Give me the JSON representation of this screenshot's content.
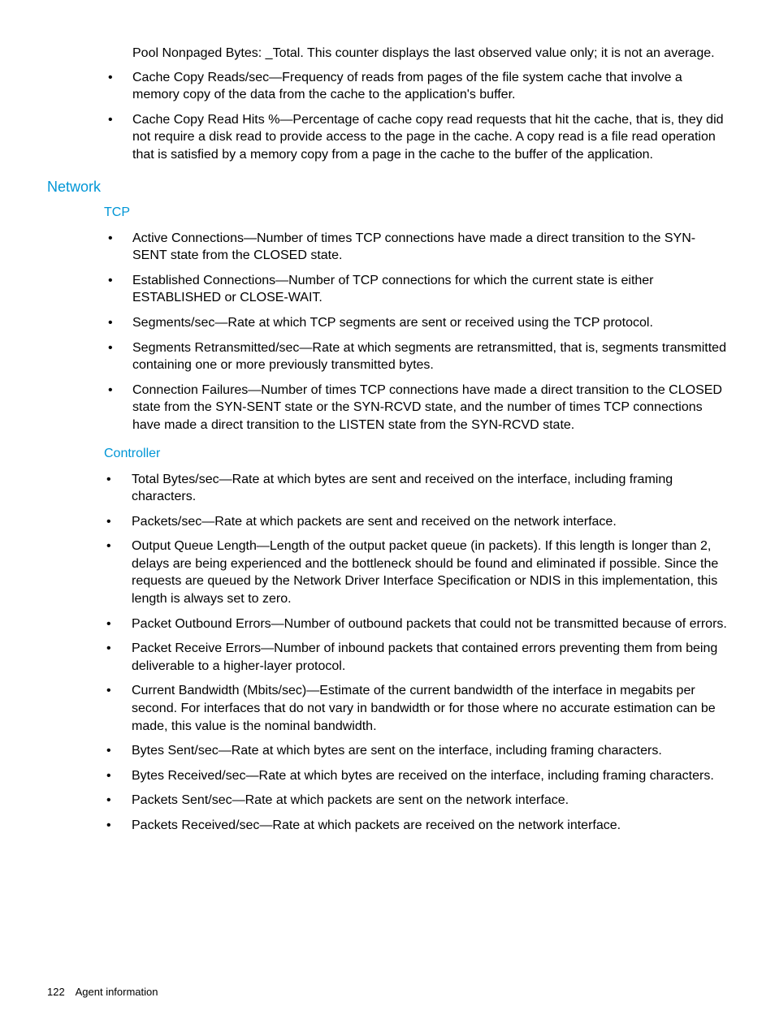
{
  "intro": "Pool Nonpaged Bytes: _Total.  This counter displays the last observed value only; it is not an average.",
  "top_bullets": [
    "Cache Copy Reads/sec—Frequency of reads from pages of the file system cache that involve a memory copy of the data from the cache to the application's buffer.",
    "Cache Copy Read Hits %—Percentage of cache copy read requests that hit the cache, that is, they did not require a disk read to provide access to the page in the cache. A copy read is a file read operation that is satisfied by a memory copy from a page in the cache to the buffer of the application."
  ],
  "heading_network": "Network",
  "heading_tcp": "TCP",
  "tcp_bullets": [
    "Active Connections—Number of times TCP connections have made a direct transition to the SYN-SENT state from the CLOSED state.",
    "Established Connections—Number of TCP connections for which the current state is either ESTABLISHED or CLOSE-WAIT.",
    "Segments/sec—Rate at which TCP segments are sent or received using the TCP protocol.",
    "Segments Retransmitted/sec—Rate at which segments are retransmitted, that is, segments transmitted containing one or more previously transmitted bytes.",
    "Connection Failures—Number of times TCP connections have made a direct transition to the CLOSED state from the SYN-SENT state or the SYN-RCVD state, and the number of times TCP connections have made a direct transition to the LISTEN state from the SYN-RCVD state."
  ],
  "heading_controller": "Controller",
  "controller_bullets": [
    "Total Bytes/sec—Rate at which bytes are sent and received on the interface, including framing characters.",
    "Packets/sec—Rate at which packets are sent and received on the network interface.",
    "Output Queue Length—Length of the output packet queue (in packets). If this length is longer than 2, delays are being experienced and the bottleneck should be found and eliminated if possible. Since the requests are queued by the Network Driver Interface Specification or NDIS in this implementation, this length is always set to zero.",
    "Packet Outbound Errors—Number of outbound packets that could not be transmitted because of errors.",
    "Packet Receive Errors—Number of inbound packets that contained errors preventing them from being deliverable to a higher-layer protocol.",
    "Current Bandwidth (Mbits/sec)—Estimate of the current bandwidth of the interface in megabits per second. For interfaces that do not vary in bandwidth or for those where no accurate estimation can be made, this value is the nominal bandwidth.",
    "Bytes Sent/sec—Rate at which bytes are sent on the interface, including framing characters.",
    "Bytes Received/sec—Rate at which bytes are received on the interface, including framing characters.",
    "Packets Sent/sec—Rate at which packets are sent on the network interface.",
    "Packets Received/sec—Rate at which packets are received on the network interface."
  ],
  "footer": {
    "page": "122",
    "title": "Agent information"
  }
}
